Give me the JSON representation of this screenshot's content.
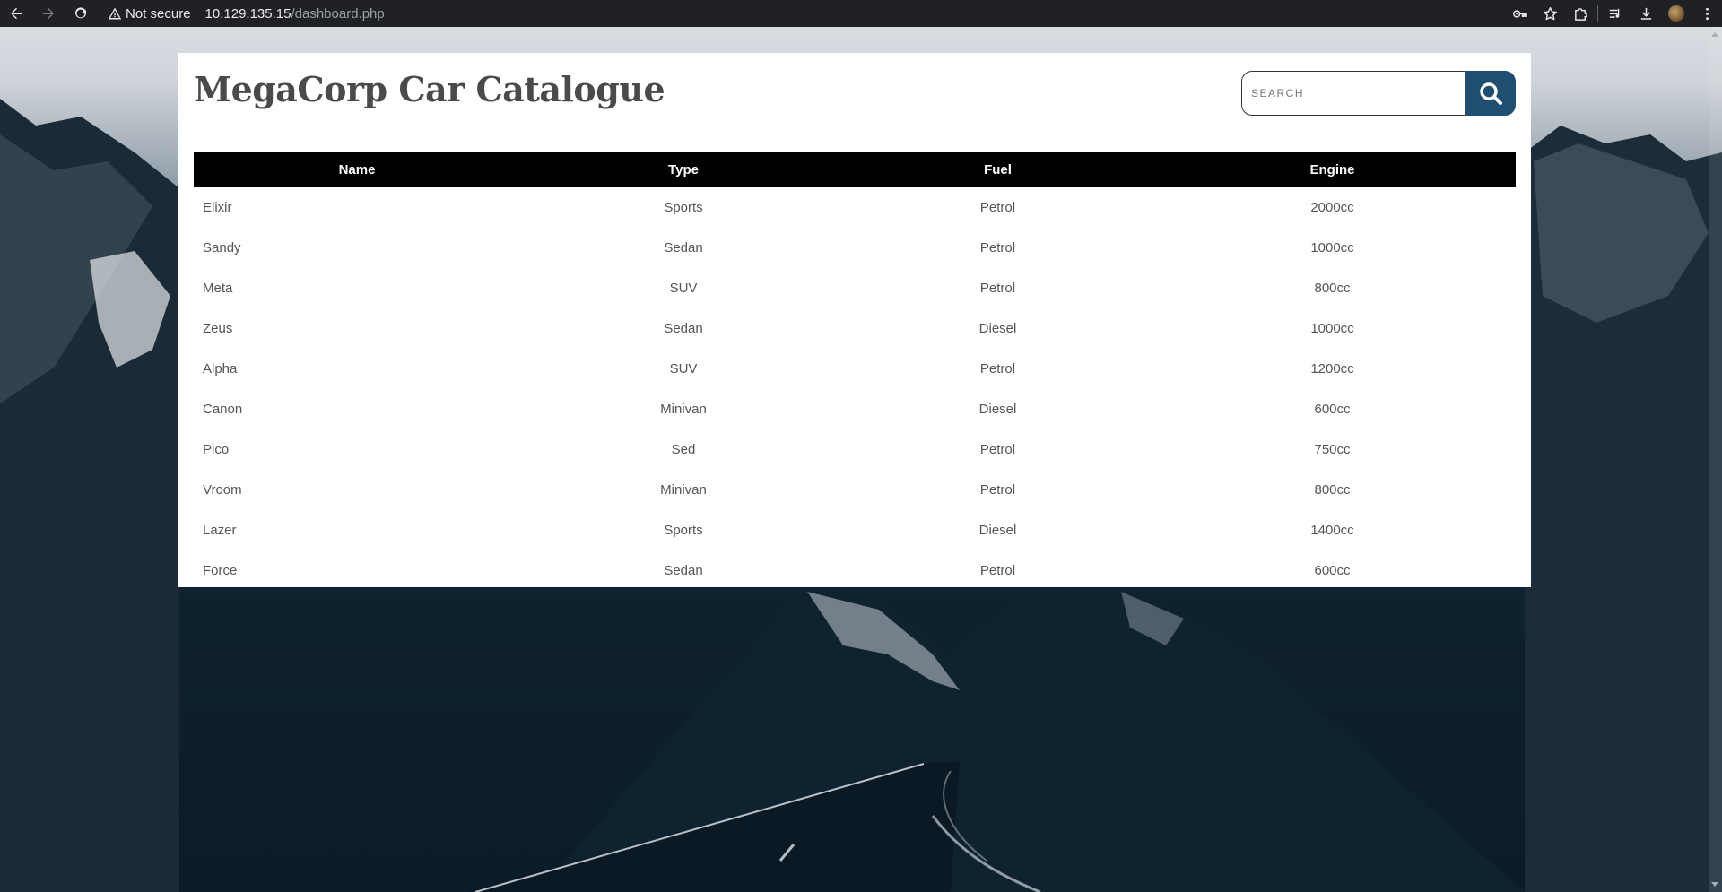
{
  "browser": {
    "security_label": "Not secure",
    "url_host": "10.129.135.15",
    "url_path": "/dashboard.php",
    "icons": [
      "back-icon",
      "forward-icon",
      "reload-icon",
      "warning-icon",
      "key-icon",
      "star-icon",
      "extensions-icon",
      "media-icon",
      "download-icon",
      "avatar",
      "menu-icon"
    ]
  },
  "page": {
    "title": "MegaCorp Car Catalogue",
    "search": {
      "placeholder": "SEARCH",
      "button_icon": "search-icon"
    }
  },
  "table": {
    "headers": {
      "name": "Name",
      "type": "Type",
      "fuel": "Fuel",
      "engine": "Engine"
    },
    "rows": [
      {
        "name": "Elixir",
        "type": "Sports",
        "fuel": "Petrol",
        "engine": "2000cc"
      },
      {
        "name": "Sandy",
        "type": "Sedan",
        "fuel": "Petrol",
        "engine": "1000cc"
      },
      {
        "name": "Meta",
        "type": "SUV",
        "fuel": "Petrol",
        "engine": "800cc"
      },
      {
        "name": "Zeus",
        "type": "Sedan",
        "fuel": "Diesel",
        "engine": "1000cc"
      },
      {
        "name": "Alpha",
        "type": "SUV",
        "fuel": "Petrol",
        "engine": "1200cc"
      },
      {
        "name": "Canon",
        "type": "Minivan",
        "fuel": "Diesel",
        "engine": "600cc"
      },
      {
        "name": "Pico",
        "type": "Sed",
        "fuel": "Petrol",
        "engine": "750cc"
      },
      {
        "name": "Vroom",
        "type": "Minivan",
        "fuel": "Petrol",
        "engine": "800cc"
      },
      {
        "name": "Lazer",
        "type": "Sports",
        "fuel": "Diesel",
        "engine": "1400cc"
      },
      {
        "name": "Force",
        "type": "Sedan",
        "fuel": "Petrol",
        "engine": "600cc"
      }
    ]
  },
  "colors": {
    "chrome_bg": "#202124",
    "table_header_bg": "#000000",
    "search_button_bg": "#1f4e70",
    "title_color": "#4a4a4a",
    "cell_text": "#555555"
  }
}
